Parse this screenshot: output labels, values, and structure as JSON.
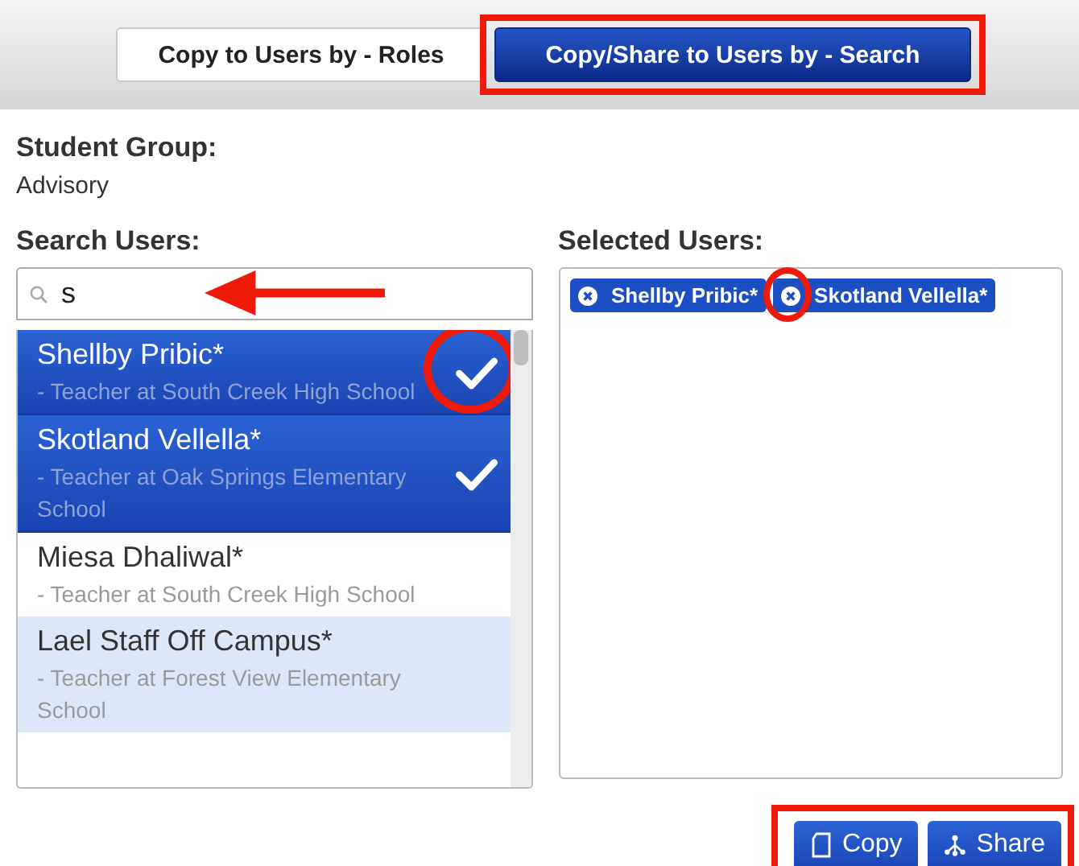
{
  "tabs": [
    {
      "label": "Copy to Users by - Roles",
      "selected": false,
      "annotated": false
    },
    {
      "label": "Copy/Share to Users by - Search",
      "selected": true,
      "annotated": true
    }
  ],
  "student_group": {
    "label": "Student Group:",
    "value": "Advisory"
  },
  "search": {
    "label": "Search Users:",
    "value": "s",
    "annotated": true
  },
  "results": [
    {
      "name": "Shellby Pribic*",
      "role": "- Teacher at South Creek High School",
      "selected": true,
      "hovered": false,
      "annotated": true
    },
    {
      "name": "Skotland Vellella*",
      "role": "- Teacher at Oak Springs Elementary School",
      "selected": true,
      "hovered": false,
      "annotated": false
    },
    {
      "name": "Miesa Dhaliwal*",
      "role": "- Teacher at South Creek High School",
      "selected": false,
      "hovered": false,
      "annotated": false
    },
    {
      "name": "Lael Staff Off Campus*",
      "role": "- Teacher at Forest View Elementary School",
      "selected": false,
      "hovered": true,
      "annotated": false
    }
  ],
  "selected_users": {
    "label": "Selected Users:",
    "tags": [
      {
        "label": "Shellby Pribic*",
        "annotated": false
      },
      {
        "label": "Skotland Vellella*",
        "annotated": true
      }
    ]
  },
  "buttons": [
    {
      "label": "Copy",
      "kind": "copy"
    },
    {
      "label": "Share",
      "kind": "share"
    }
  ],
  "buttons_annotated": true
}
